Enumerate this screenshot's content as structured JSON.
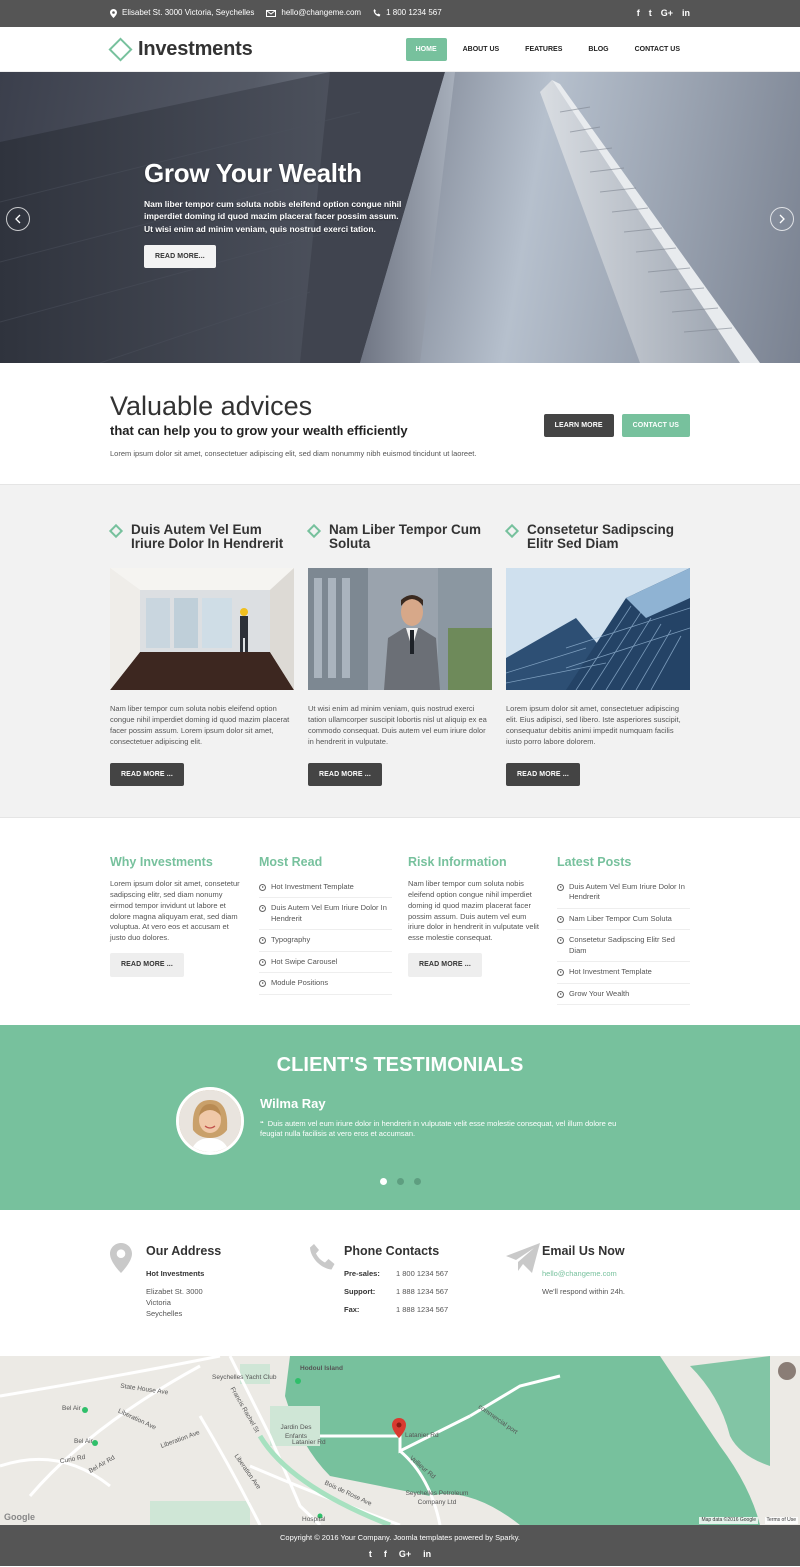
{
  "topbar": {
    "address": "Elisabet St. 3000 Victoria, Seychelles",
    "email": "hello@changeme.com",
    "phone": "1 800 1234 567",
    "social": [
      "f",
      "t",
      "G+",
      "in"
    ]
  },
  "header": {
    "logo": "Investments",
    "nav": [
      "HOME",
      "ABOUT US",
      "FEATURES",
      "BLOG",
      "CONTACT US"
    ],
    "active_nav": "HOME"
  },
  "hero": {
    "title": "Grow Your Wealth",
    "text": "Nam liber tempor cum soluta nobis eleifend option congue nihil imperdiet doming id quod mazim placerat facer possim assum. Ut wisi enim ad minim veniam, quis nostrud exerci tation.",
    "button": "READ MORE..."
  },
  "advices": {
    "title": "Valuable advices",
    "subtitle": "that can help you to grow your wealth efficiently",
    "text": "Lorem ipsum dolor sit amet, consectetuer adipiscing elit, sed diam nonummy nibh euismod tincidunt ut laoreet.",
    "learn_more": "LEARN MORE",
    "contact_us": "CONTACT US"
  },
  "features": [
    {
      "title": "Duis Autem Vel Eum Iriure Dolor In Hendrerit",
      "text": "Nam liber tempor cum soluta nobis eleifend option congue nihil imperdiet doming id quod mazim placerat facer possim assum. Lorem ipsum dolor sit amet, consectetuer adipiscing elit.",
      "button": "READ MORE ..."
    },
    {
      "title": "Nam Liber Tempor Cum Soluta",
      "text": "Ut wisi enim ad minim veniam, quis nostrud exerci tation ullamcorper suscipit lobortis nisl ut aliquip ex ea commodo consequat. Duis autem vel eum iriure dolor in hendrerit in vulputate.",
      "button": "READ MORE ..."
    },
    {
      "title": "Consetetur Sadipscing Elitr Sed Diam",
      "text": "Lorem ipsum dolor sit amet, consectetuer adipiscing elit. Eius adipisci, sed libero. Iste asperiores suscipit, consequatur debitis animi impedit numquam facilis iusto porro labore dolorem.",
      "button": "READ MORE ..."
    }
  ],
  "widgets": {
    "why": {
      "title": "Why Investments",
      "text": "Lorem ipsum dolor sit amet, consetetur sadipscing elitr, sed diam nonumy eirmod tempor invidunt ut labore et dolore magna aliquyam erat, sed diam voluptua. At vero eos et accusam et justo duo dolores.",
      "button": "READ MORE ..."
    },
    "most_read": {
      "title": "Most Read",
      "items": [
        "Hot Investment Template",
        "Duis Autem Vel Eum Iriure Dolor In Hendrerit",
        "Typography",
        "Hot Swipe Carousel",
        "Module Positions"
      ]
    },
    "risk": {
      "title": "Risk Information",
      "text": "Nam liber tempor cum soluta nobis eleifend option congue nihil imperdiet doming id quod mazim placerat facer possim assum. Duis autem vel eum iriure dolor in hendrerit in vulputate velit esse molestie consequat.",
      "button": "READ MORE ..."
    },
    "latest": {
      "title": "Latest Posts",
      "items": [
        "Duis Autem Vel Eum Iriure Dolor In Hendrerit",
        "Nam Liber Tempor Cum Soluta",
        "Consetetur Sadipscing Elitr Sed Diam",
        "Hot Investment Template",
        "Grow Your Wealth"
      ]
    }
  },
  "testimonials": {
    "title": "CLIENT'S TESTIMONIALS",
    "name": "Wilma Ray",
    "quote": "Duis autem vel eum iriure dolor in hendrerit in vulputate velit esse molestie consequat, vel illum dolore eu feugiat nulla facilisis at vero eros et accumsan.",
    "quote_mark": "“",
    "dots": 3,
    "active_dot": 1
  },
  "contact": {
    "address": {
      "title": "Our Address",
      "company": "Hot Investments",
      "lines": [
        "Elizabet St. 3000",
        "Victoria",
        "Seychelles"
      ]
    },
    "phone": {
      "title": "Phone Contacts",
      "rows": [
        {
          "label": "Pre-sales:",
          "value": "1 800 1234 567"
        },
        {
          "label": "Support:",
          "value": "1 888 1234 567"
        },
        {
          "label": "Fax:",
          "value": "1 888 1234 567"
        }
      ]
    },
    "email": {
      "title": "Email Us Now",
      "address": "hello@changeme.com",
      "note": "We'll respond within 24h."
    }
  },
  "map": {
    "labels": {
      "hodoul": "Hodoul Island",
      "yacht": "Seychelles Yacht Club",
      "state_house": "State House Ave",
      "bel_air1": "Bel Air",
      "bel_air2": "Bel Air",
      "bel_air3": "Bel Air Rd",
      "liberation1": "Liberation Ave",
      "liberation2": "Liberation Ave",
      "liberation3": "Liberation Ave",
      "francis": "Francis Rachel St",
      "jardin": "Jardin Des Enfants",
      "latanier1": "Latanier Rd",
      "latanier2": "Latanier Rd",
      "commercial": "commercial port",
      "vellieur": "Vellieur Rd",
      "bois": "Bois de Rose Ave",
      "petroleum": "Seychelles Petroleum Company Ltd",
      "curio": "Curio Rd",
      "hospital": "Hospital",
      "google": "Google",
      "map_data": "Map data ©2016 Google",
      "terms": "Terms of Use"
    },
    "water_color": "#77c19d"
  },
  "footer": {
    "copyright": "Copyright © 2016 Your Company. Joomla templates powered by Sparky.",
    "social": [
      "t",
      "f",
      "G+",
      "in"
    ]
  },
  "colors": {
    "accent": "#77c19d",
    "dark": "#555555"
  }
}
